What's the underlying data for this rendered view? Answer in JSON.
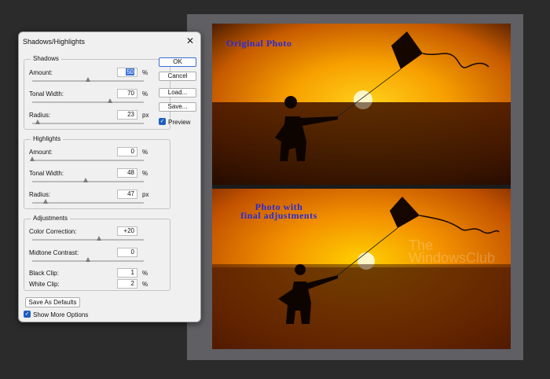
{
  "dialog": {
    "title": "Shadows/Highlights",
    "close_icon": "close-icon",
    "shadows": {
      "legend": "Shadows",
      "amount": {
        "label": "Amount:",
        "value": "50",
        "unit": "%",
        "level": 0.5
      },
      "tonal_width": {
        "label": "Tonal Width:",
        "value": "70",
        "unit": "%",
        "level": 0.7
      },
      "radius": {
        "label": "Radius:",
        "value": "23",
        "unit": "px",
        "level": 0.05
      }
    },
    "highlights": {
      "legend": "Highlights",
      "amount": {
        "label": "Amount:",
        "value": "0",
        "unit": "%",
        "level": 0.0
      },
      "tonal_width": {
        "label": "Tonal Width:",
        "value": "48",
        "unit": "%",
        "level": 0.48
      },
      "radius": {
        "label": "Radius:",
        "value": "47",
        "unit": "px",
        "level": 0.12
      }
    },
    "adjustments": {
      "legend": "Adjustments",
      "color_correction": {
        "label": "Color Correction:",
        "value": "+20",
        "level": 0.6
      },
      "midtone_contrast": {
        "label": "Midtone Contrast:",
        "value": "0",
        "level": 0.5
      },
      "black_clip": {
        "label": "Black Clip:",
        "value": "1",
        "unit": "%"
      },
      "white_clip": {
        "label": "White Clip:",
        "value": "2",
        "unit": "%"
      }
    },
    "buttons": {
      "ok": "OK",
      "cancel": "Cancel",
      "load": "Load...",
      "save": "Save..."
    },
    "preview": {
      "label": "Preview",
      "checked": true
    },
    "save_as_defaults": "Save As Defaults",
    "show_more_options": {
      "label": "Show More Options",
      "checked": true
    }
  },
  "document": {
    "top_caption": "Original Photo",
    "bottom_caption_line1": "Photo with",
    "bottom_caption_line2": "final adjustments",
    "watermark_line1": "The",
    "watermark_line2": "WindowsClub"
  },
  "colors": {
    "accent": "#3a6fd8",
    "caption": "#2b2bd6"
  }
}
